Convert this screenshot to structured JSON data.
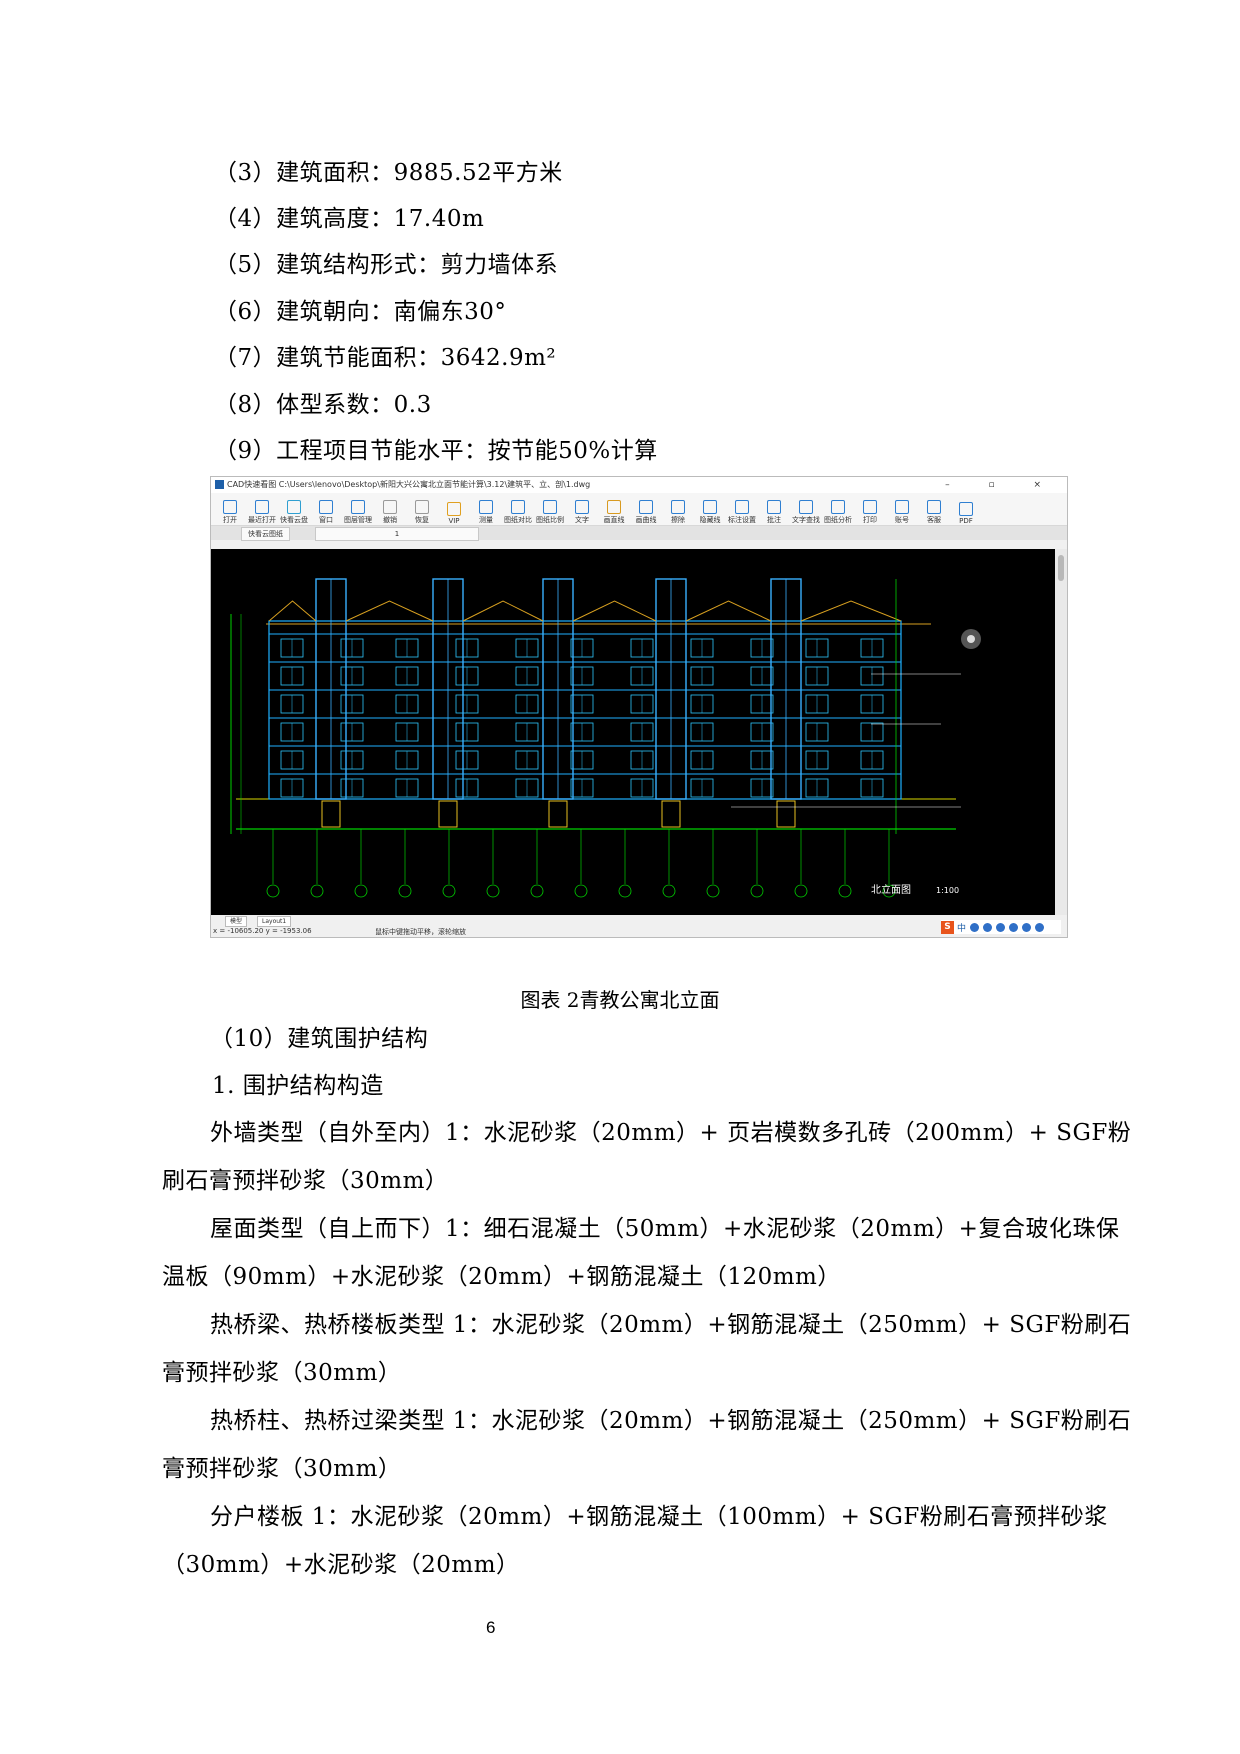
{
  "specs": [
    "（3）建筑面积：9885.52平方米",
    "（4）建筑高度：17.40m",
    "（5）建筑结构形式：剪力墙体系",
    "（6）建筑朝向：南偏东30°",
    "（7）建筑节能面积：3642.9m²",
    "（8）体型系数：0.3",
    "（9）工程项目节能水平：按节能50%计算"
  ],
  "cad": {
    "title": "CAD快速看图    C:\\Users\\lenovo\\Desktop\\新阳大兴公寓北立面节能计算\\3.12\\建筑平、立、剖\\1.dwg",
    "window_controls": "–  ▫  ×",
    "toolbar": [
      "打开",
      "最近打开",
      "快看云盘",
      "窗口",
      "图层管理",
      "撤销",
      "恢复",
      "VIP",
      "测量",
      "图纸对比",
      "图纸比例",
      "文字",
      "画直线",
      "画曲线",
      "擦除",
      "隐藏线",
      "标注设置",
      "批注",
      "文字查找",
      "图纸分析",
      "打印",
      "账号",
      "客服",
      "PDF"
    ],
    "tabs": [
      "快看云图纸",
      "1"
    ],
    "status_tabs": [
      "模型",
      "Layout1"
    ],
    "coords": "x = -10605.20  y = -1953.06",
    "status_msg": "鼠标中键拖动平移，滚轮缩放",
    "drawing_title": "北立面图",
    "drawing_scale": "1:100",
    "ime_label": "中"
  },
  "caption": "图表 2青教公寓北立面",
  "section_title": "（10）建筑围护结构",
  "subsection_title": "1. 围护结构构造",
  "paragraphs": [
    [
      "外墙类型（自外至内）1：水泥砂浆（20mm）+ 页岩模数多孔砖（200mm）+ SGF粉",
      "刷石膏预拌砂浆（30mm）"
    ],
    [
      "屋面类型（自上而下）1：细石混凝土（50mm）+水泥砂浆（20mm）+复合玻化珠保",
      "温板（90mm）+水泥砂浆（20mm）+钢筋混凝土（120mm）"
    ],
    [
      "热桥梁、热桥楼板类型 1：水泥砂浆（20mm）+钢筋混凝土（250mm）+ SGF粉刷石",
      "膏预拌砂浆（30mm）"
    ],
    [
      "热桥柱、热桥过梁类型 1：水泥砂浆（20mm）+钢筋混凝土（250mm）+ SGF粉刷石",
      "膏预拌砂浆（30mm）"
    ],
    [
      "分户楼板 1：水泥砂浆（20mm）+钢筋混凝土（100mm）+ SGF粉刷石膏预拌砂浆",
      "（30mm）+水泥砂浆（20mm）"
    ]
  ],
  "page_number": "6"
}
